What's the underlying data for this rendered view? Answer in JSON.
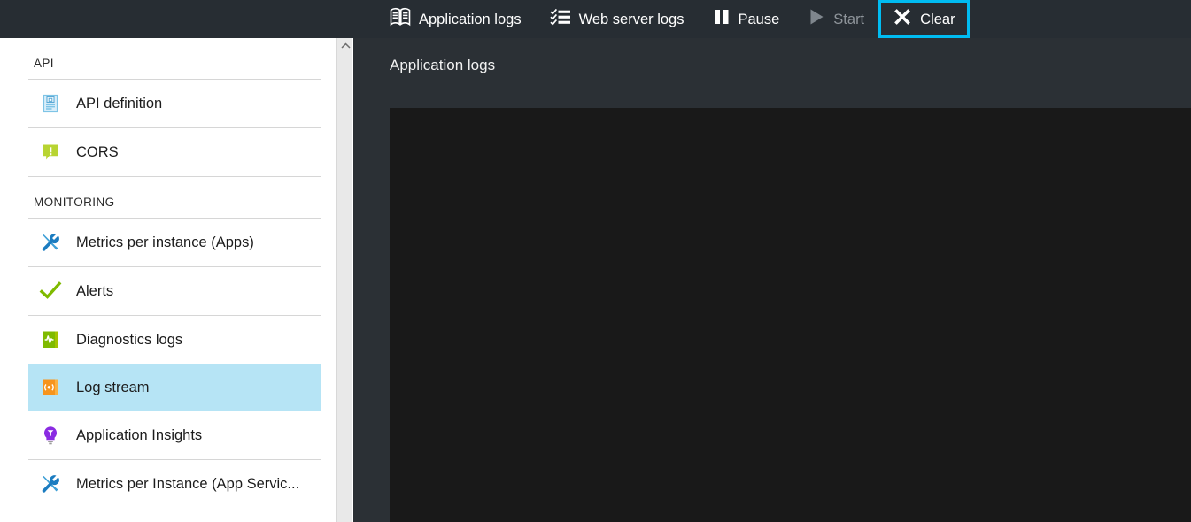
{
  "toolbar": {
    "buttons": [
      {
        "label": "Application logs",
        "icon": "book-icon",
        "state": "enabled",
        "focused": false
      },
      {
        "label": "Web server logs",
        "icon": "checklist-icon",
        "state": "enabled",
        "focused": false
      },
      {
        "label": "Pause",
        "icon": "pause-icon",
        "state": "enabled",
        "focused": false
      },
      {
        "label": "Start",
        "icon": "play-icon",
        "state": "disabled",
        "focused": false
      },
      {
        "label": "Clear",
        "icon": "close-x-icon",
        "state": "enabled",
        "focused": true
      }
    ],
    "focus_outline_color": "#00bcf2",
    "background_color": "#272d33",
    "disabled_text_color": "#8e949a"
  },
  "sidebar": {
    "sections": [
      {
        "title": "API",
        "items": [
          {
            "label": "API definition",
            "icon": "api-definition-document-icon",
            "icon_color": "#a6d8ef",
            "selected": false
          },
          {
            "label": "CORS",
            "icon": "cors-alert-bubble-icon",
            "icon_color": "#b8d432",
            "selected": false
          }
        ]
      },
      {
        "title": "MONITORING",
        "items": [
          {
            "label": "Metrics per instance (Apps)",
            "icon": "tools-icon",
            "icon_color": "#0078d7",
            "selected": false
          },
          {
            "label": "Alerts",
            "icon": "checkmark-icon",
            "icon_color": "#7fba00",
            "selected": false
          },
          {
            "label": "Diagnostics logs",
            "icon": "diagnostics-book-icon",
            "icon_color": "#7fba00",
            "selected": false
          },
          {
            "label": "Log stream",
            "icon": "log-stream-book-icon",
            "icon_color": "#f7941d",
            "selected": true
          },
          {
            "label": "Application Insights",
            "icon": "lightbulb-icon",
            "icon_color": "#8a2be2",
            "selected": false
          },
          {
            "label": "Metrics per Instance (App Servic...",
            "icon": "tools-icon",
            "icon_color": "#0078d7",
            "selected": false
          }
        ]
      }
    ],
    "selected_highlight_color": "#b6e4f5"
  },
  "scrollbar": {
    "up_arrow_icon": "chevron-up-icon",
    "track_color": "#e9e9e9"
  },
  "main": {
    "title": "Application logs",
    "console_text": "",
    "panel_color": "#2b3035",
    "console_color": "#191919"
  }
}
